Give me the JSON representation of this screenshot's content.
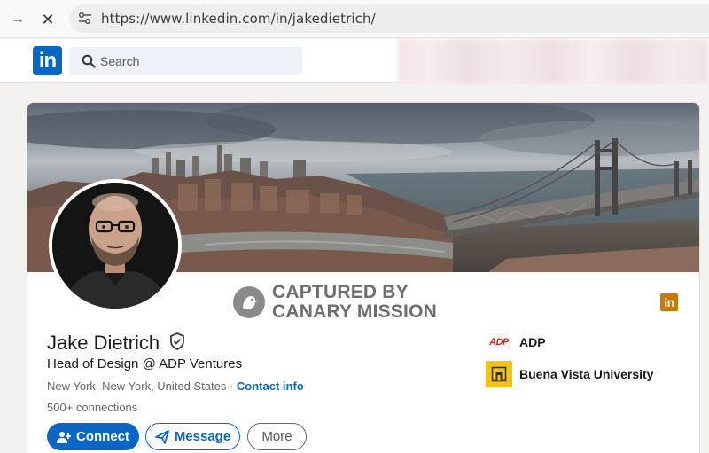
{
  "browser": {
    "url": "https://www.linkedin.com/in/jakedietrich/"
  },
  "header": {
    "logo_text": "in",
    "search_placeholder": "Search"
  },
  "watermark": {
    "line1": "CAPTURED BY",
    "line2": "CANARY MISSION"
  },
  "profile": {
    "name": "Jake Dietrich",
    "headline": "Head of Design @ ADP Ventures",
    "location": "New York, New York, United States",
    "separator": " · ",
    "contact_info": "Contact info",
    "connections": "500+ connections",
    "li_badge": "in"
  },
  "actions": {
    "connect": "Connect",
    "message": "Message",
    "more": "More"
  },
  "experience": [
    {
      "logo_text": "ADP",
      "name": "ADP"
    },
    {
      "name": "Buena Vista University"
    }
  ],
  "colors": {
    "linkedin_blue": "#0a66c2",
    "adp_red": "#d0271d",
    "bvu_gold": "#f6c315"
  }
}
